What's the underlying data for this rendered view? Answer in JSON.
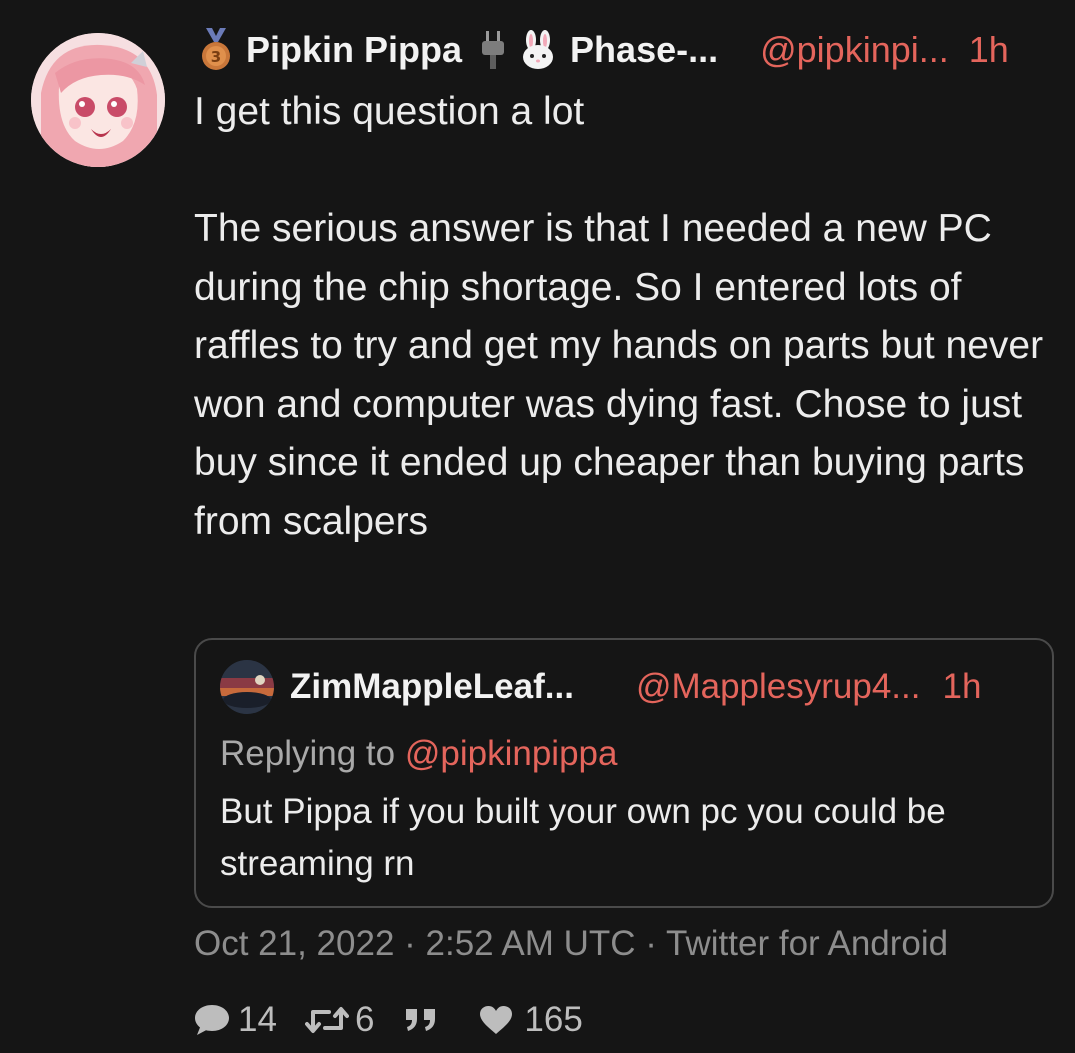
{
  "tweet": {
    "author_name": "Pipkin Pippa",
    "author_name_suffix": "Phase-...",
    "handle": "@pipkinpi...",
    "time": "1h",
    "icons": [
      "medal-icon",
      "plug-icon",
      "bunny-icon"
    ],
    "text": "I get this question a lot\n\nThe serious answer is that I needed a new PC during the chip shortage. So I entered lots of raffles to try and get my hands on parts but never won and computer was dying fast. Chose to just buy since it ended up cheaper than buying parts from scalpers",
    "quoted": {
      "author_name": "ZimMappleLeaf...",
      "handle": "@Mapplesyrup4...",
      "time": "1h",
      "replying_prefix": "Replying to",
      "replying_mention": "@pipkinpippa",
      "text": "But Pippa if you built your own pc you could be streaming rn"
    },
    "meta": "Oct 21, 2022 · 2:52 AM UTC · Twitter for Android",
    "stats": {
      "replies": "14",
      "retweets": "6",
      "quotes_icon": "quote-icon",
      "likes": "165"
    }
  },
  "colors": {
    "background": "#151515",
    "accent": "#e4655c",
    "text": "#ececec",
    "muted": "#8d8d8d",
    "border": "#4a4a4a"
  }
}
